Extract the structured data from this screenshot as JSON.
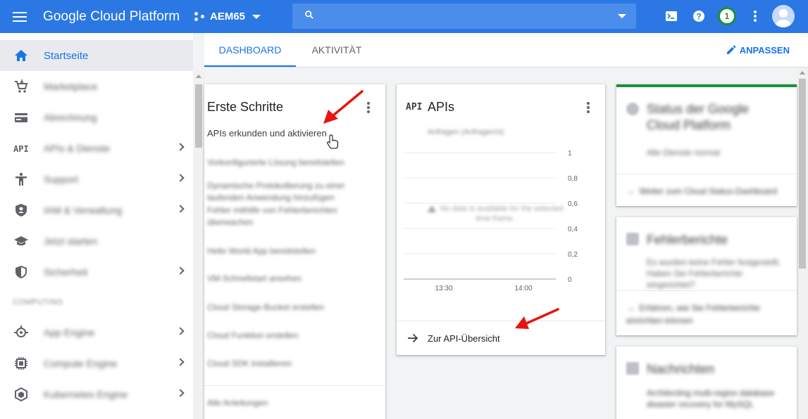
{
  "header": {
    "brand": "Google Cloud Platform",
    "project": "AEM65",
    "search_placeholder": "",
    "notification_count": "1"
  },
  "sidebar": {
    "items": [
      {
        "label": "Startseite",
        "icon": "home-icon",
        "active": true,
        "chevron": false
      },
      {
        "label": "Marketplace",
        "icon": "cart-icon",
        "chevron": false
      },
      {
        "label": "Abrechnung",
        "icon": "billing-icon",
        "chevron": false
      },
      {
        "label": "APIs & Dienste",
        "icon": "api-icon",
        "chevron": true
      },
      {
        "label": "Support",
        "icon": "support-icon",
        "chevron": true
      },
      {
        "label": "IAM & Verwaltung",
        "icon": "shield-icon",
        "chevron": true
      },
      {
        "label": "Jetzt starten",
        "icon": "graduation-cap-icon",
        "chevron": false
      },
      {
        "label": "Sicherheit",
        "icon": "security-shield-icon",
        "chevron": true
      }
    ],
    "section_label": "COMPUTING",
    "compute_items": [
      {
        "label": "App Engine",
        "icon": "app-engine-icon",
        "chevron": true
      },
      {
        "label": "Compute Engine",
        "icon": "chip-icon",
        "chevron": true
      },
      {
        "label": "Kubernetes Engine",
        "icon": "kubernetes-icon",
        "chevron": true
      }
    ]
  },
  "tabs": [
    {
      "label": "DASHBOARD",
      "active": true
    },
    {
      "label": "AKTIVITÄT",
      "active": false
    }
  ],
  "customize_label": "ANPASSEN",
  "steps_card": {
    "title": "Erste Schritte",
    "primary_link": "APIs erkunden und aktivieren",
    "links": [
      "Vorkonfigurierte Lösung bereitstellen",
      "Dynamische Protokollierung zu einer laufenden Anwendung hinzufügen",
      "Fehler mithilfe von Fehlerberichten überwachen",
      "Hello World App bereitstellen",
      "VM-Schnellstart ansehen",
      "Cloud Storage-Bucket erstellen",
      "Cloud Funktion erstellen",
      "Cloud SDK installieren"
    ],
    "footer": "Alle Anleitungen"
  },
  "apis_card": {
    "badge": "API",
    "title": "APIs",
    "chart_title": "Anfragen (Anfragen/s)",
    "no_data": "No data is available for the selected time frame.",
    "footer": "Zur API-Übersicht"
  },
  "chart_data": {
    "type": "line",
    "title": "Anfragen (Anfragen/s)",
    "xlabel": "",
    "ylabel": "",
    "x_ticks": [
      "13:30",
      "14:00"
    ],
    "y_ticks": [
      "1",
      "0,8",
      "0,6",
      "0,4",
      "0,2",
      "0"
    ],
    "ylim": [
      0,
      1
    ],
    "series": []
  },
  "status_card": {
    "title": "Status der Google Cloud Platform",
    "body": "Alle Dienste normal",
    "footer": "Weiter zum Cloud Status-Dashboard",
    "accent": "#1e8e3e"
  },
  "errors_card": {
    "title": "Fehlerberichte",
    "body": "Es wurden keine Fehler festgestellt. Haben Sie Fehlerberichte eingerichtet?",
    "footer": "Erfahren, wie Sie Fehlerberichte einrichten können"
  },
  "news_card": {
    "title": "Nachrichten",
    "body": "Architecting multi-region database disaster recovery for MySQL"
  },
  "colors": {
    "header": "#2b78e4",
    "accent": "#1a73e8",
    "annotation": "#e8140f"
  }
}
